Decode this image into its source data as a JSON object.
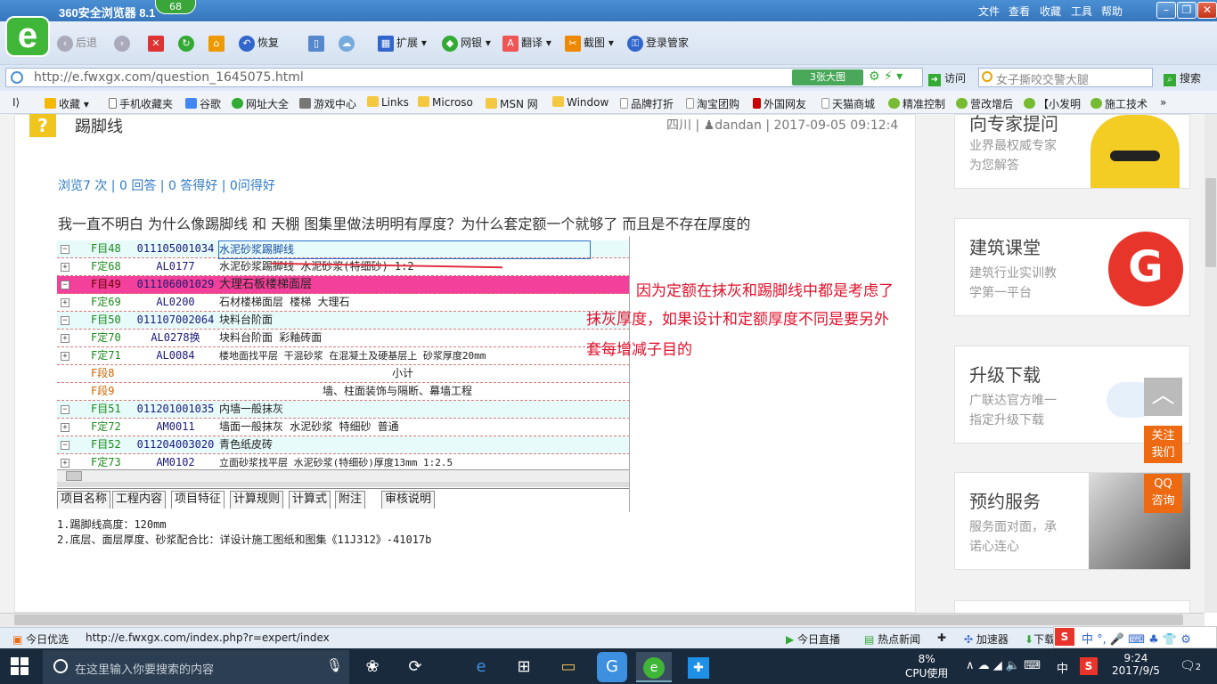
{
  "browser": {
    "title": "360安全浏览器 8.1",
    "badge": "68",
    "menu": [
      "文件",
      "查看",
      "收藏",
      "工具",
      "帮助"
    ],
    "toolbar": {
      "back": "后退",
      "restore": "恢复",
      "extend": "扩展",
      "netbank": "网银",
      "translate": "翻译",
      "screenshot": "截图",
      "login": "登录管家"
    },
    "url": "http://e.fwxgx.com/question_1645075.html",
    "image_btn": "3张大图",
    "visit": "访问",
    "search_placeholder": "女子撕咬交警大腿",
    "search_btn": "搜索",
    "bookmarks": [
      "收藏",
      "手机收藏夹",
      "谷歌",
      "网址大全",
      "游戏中心",
      "Links",
      "Microso",
      "MSN 网",
      "Window",
      "品牌打折",
      "淘宝团购",
      "外国网友",
      "天猫商城",
      "精准控制",
      "营改增后",
      "【小发明",
      "施工技术"
    ]
  },
  "question": {
    "title": "踢脚线",
    "meta_region": "四川 |",
    "meta_user": "dandan",
    "meta_time": "| 2017-09-05 09:12:4",
    "stats": "浏览7 次 | 0 回答 | 0 答得好 | 0问得好",
    "body": "我一直不明白  为什么像踢脚线   和 天棚 图集里做法明明有厚度？为什么套定额一个就够了    而且是不存在厚度的"
  },
  "table": {
    "rows": [
      {
        "a": "F目48",
        "b": "011105001034",
        "c": "水泥砂浆踢脚线"
      },
      {
        "a": "F定68",
        "b": "AL0177",
        "c": "水泥砂浆踢脚线 水泥砂浆(特细砂) 1:2"
      },
      {
        "a": "F目49",
        "b": "011106001029",
        "c": "大理石板楼梯面层"
      },
      {
        "a": "F定69",
        "b": "AL0200",
        "c": "石材楼梯面层 楼梯 大理石"
      },
      {
        "a": "F目50",
        "b": "011107002064",
        "c": "块料台阶面"
      },
      {
        "a": "F定70",
        "b": "AL0278换",
        "c": "块料台阶面 彩釉砖面"
      },
      {
        "a": "F定71",
        "b": "AL0084",
        "c": "楼地面找平层 干混砂浆 在混凝土及硬基层上 砂浆厚度20mm"
      },
      {
        "a": "F段8",
        "b": "",
        "c": "小计"
      },
      {
        "a": "F段9",
        "b": "",
        "c": "墙、柱面装饰与隔断、幕墙工程"
      },
      {
        "a": "F目51",
        "b": "011201001035",
        "c": "内墙一般抹灰"
      },
      {
        "a": "F定72",
        "b": "AM0011",
        "c": "墙面一般抹灰 水泥砂浆 特细砂 普通"
      },
      {
        "a": "F目52",
        "b": "011204003020",
        "c": "青色纸皮砖"
      },
      {
        "a": "F定73",
        "b": "AM0102",
        "c": "立面砂浆找平层 水泥砂浆(特细砂)厚度13mm 1:2.5"
      }
    ],
    "tabs": [
      "项目名称",
      "工程内容",
      "项目特征",
      "计算规则",
      "计算式",
      "附注",
      "审核说明"
    ],
    "desc1": "1.踢脚线高度：120mm",
    "desc2": "2.底层、面层厚度、砂浆配合比：详设计施工图纸和图集《11J312》-41017b"
  },
  "annotation": [
    "因为定额在抹灰和踢脚线中都是考虑了",
    "抹灰厚度，如果设计和定额厚度不同是要另外",
    "套每增减子目的"
  ],
  "sidebar": [
    {
      "title": "向专家提问",
      "sub": [
        "业界最权威专家",
        "为您解答"
      ]
    },
    {
      "title": "建筑课堂",
      "sub": [
        "建筑行业实训教",
        "学第一平台"
      ]
    },
    {
      "title": "升级下载",
      "sub": [
        "广联达官方唯一",
        "指定升级下载"
      ]
    },
    {
      "title": "预约服务",
      "sub": [
        "服务面对面，承",
        "诺心连心"
      ]
    }
  ],
  "float": {
    "follow": "关注我们",
    "qq": "QQ咨询"
  },
  "status": {
    "today": "今日优选",
    "url": "http://e.fwxgx.com/index.php?r=expert/index",
    "live": "今日直播",
    "news": "热点新闻",
    "speed": "加速器",
    "dl": "下载"
  },
  "taskbar": {
    "search_placeholder": "在这里输入你要搜索的内容",
    "cpu": "8%",
    "cpu_label": "CPU使用",
    "ime": "中",
    "time": "9:24",
    "date": "2017/9/5",
    "notif": "2"
  }
}
